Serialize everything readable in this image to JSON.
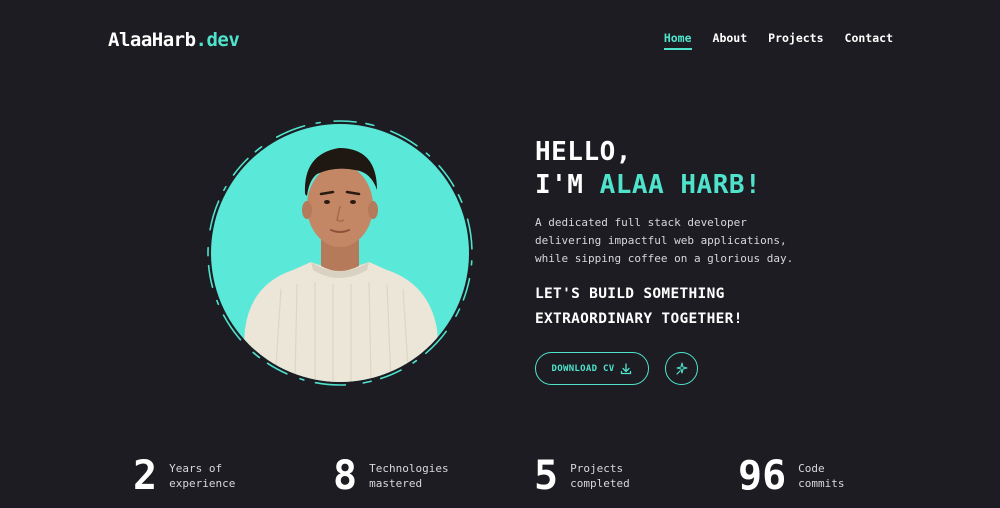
{
  "brand": {
    "name": "AlaaHarb",
    "suffix": ".dev",
    "accent_color": "#4fe3cc"
  },
  "nav": {
    "items": [
      {
        "label": "Home",
        "active": true
      },
      {
        "label": "About",
        "active": false
      },
      {
        "label": "Projects",
        "active": false
      },
      {
        "label": "Contact",
        "active": false
      }
    ]
  },
  "hero": {
    "greeting": "HELLO,",
    "intro_prefix": "I'M ",
    "name": "ALAA HARB!",
    "description": "A dedicated full stack developer delivering impactful web applications, while sipping coffee on a glorious day.",
    "tagline_line1": "LET'S BUILD SOMETHING",
    "tagline_line2": "EXTRAORDINARY TOGETHER!",
    "cv_button_label": "DOWNLOAD CV",
    "cv_icon": "download-icon",
    "extra_icon": "sparkle-icon"
  },
  "profile_photo": {
    "background_color": "#5ae8d8",
    "subject": "portrait-photo"
  },
  "stats": [
    {
      "value": "2",
      "label_line1": "Years of",
      "label_line2": "experience"
    },
    {
      "value": "8",
      "label_line1": "Technologies",
      "label_line2": "mastered"
    },
    {
      "value": "5",
      "label_line1": "Projects",
      "label_line2": "completed"
    },
    {
      "value": "96",
      "label_line1": "Code",
      "label_line2": "commits"
    }
  ]
}
